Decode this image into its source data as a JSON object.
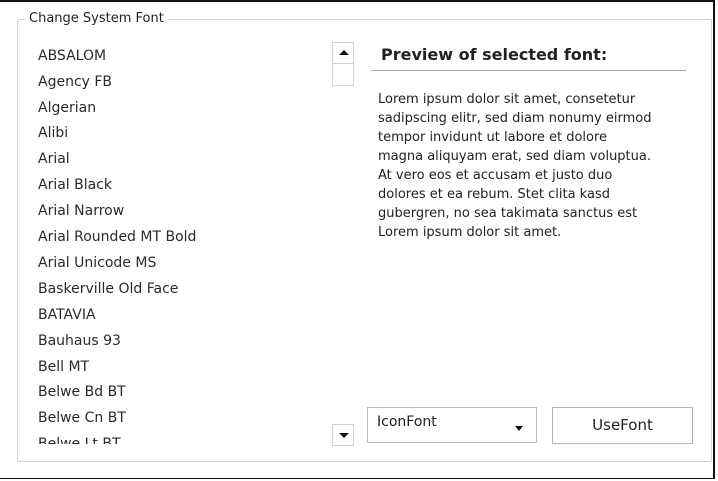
{
  "groupbox": {
    "title": "Change System Font"
  },
  "font_list": {
    "items": [
      "ABSALOM",
      "Agency FB",
      "Algerian",
      "Alibi",
      "Arial",
      "Arial Black",
      "Arial Narrow",
      "Arial Rounded MT Bold",
      "Arial Unicode MS",
      "Baskerville Old Face",
      "BATAVIA",
      "Bauhaus 93",
      "Bell MT",
      "Belwe Bd BT",
      "Belwe Cn BT",
      "Belwe Lt BT"
    ]
  },
  "preview": {
    "title": "Preview of selected font:",
    "lines": [
      "Lorem ipsum dolor sit amet, consetetur",
      "sadipscing elitr, sed diam nonumy eirmod",
      "tempor invidunt ut labore et dolore",
      "magna aliquyam erat, sed diam voluptua.",
      "At vero eos et accusam et justo duo",
      "dolores et ea rebum. Stet clita kasd",
      "gubergren, no sea takimata sanctus est",
      "Lorem ipsum dolor sit amet."
    ]
  },
  "font_combo": {
    "selected": "IconFont"
  },
  "use_font_button": {
    "label": "UseFont"
  },
  "icons": {
    "scroll_up": "triangle-up-icon",
    "scroll_down": "triangle-down-icon",
    "combo_dropdown": "chevron-down-icon"
  }
}
